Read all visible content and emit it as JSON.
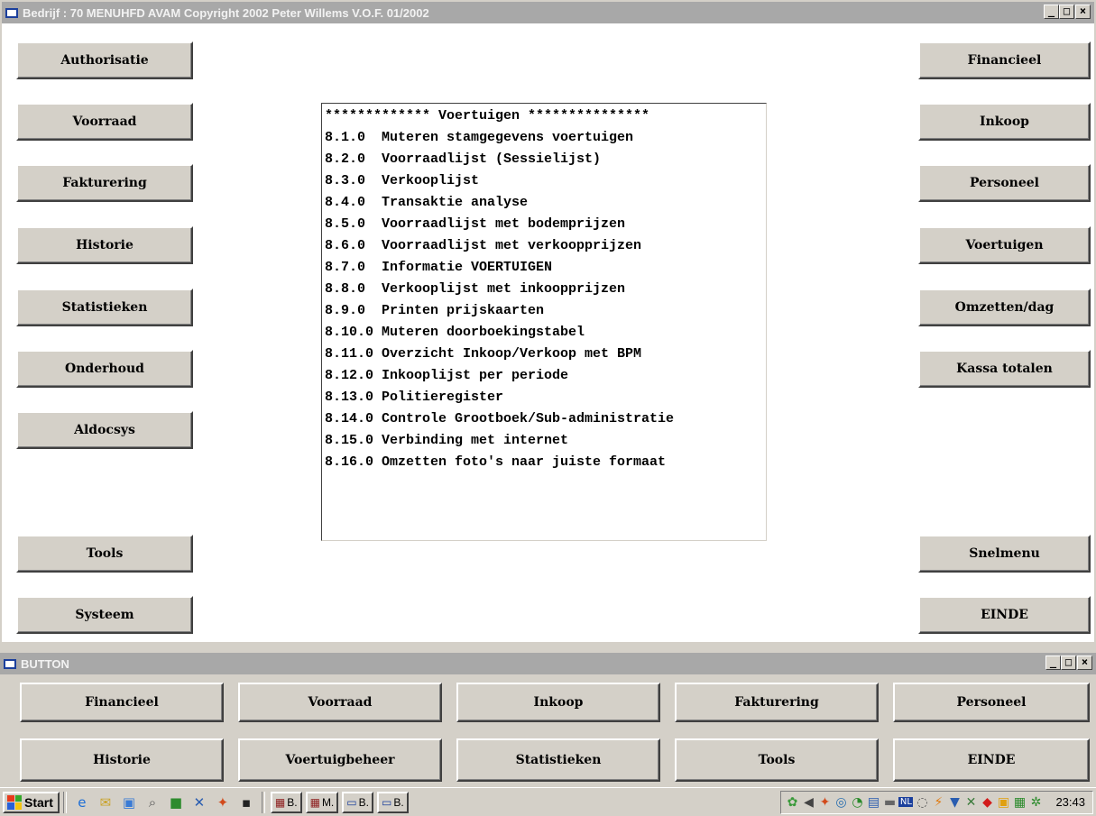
{
  "main_window": {
    "title": "Bedrijf : 70 MENUHFD   AVAM Copyright 2002 Peter Willems V.O.F.    01/2002",
    "left_buttons": [
      "Authorisatie",
      "Voorraad",
      "Fakturering",
      "Historie",
      "Statistieken",
      "Onderhoud",
      "Aldocsys",
      "Tools",
      "Systeem"
    ],
    "right_buttons": [
      "Financieel",
      "Inkoop",
      "Personeel",
      "Voertuigen",
      "Omzetten/dag",
      "Kassa totalen",
      "Snelmenu",
      "EINDE"
    ],
    "menu_lines": [
      "************* Voertuigen ***************",
      "8.1.0  Muteren stamgegevens voertuigen",
      "8.2.0  Voorraadlijst (Sessielijst)",
      "8.3.0  Verkooplijst",
      "8.4.0  Transaktie analyse",
      "8.5.0  Voorraadlijst met bodemprijzen",
      "8.6.0  Voorraadlijst met verkoopprijzen",
      "8.7.0  Informatie VOERTUIGEN",
      "8.8.0  Verkooplijst met inkoopprijzen",
      "8.9.0  Printen prijskaarten",
      "8.10.0 Muteren doorboekingstabel",
      "8.11.0 Overzicht Inkoop/Verkoop met BPM",
      "8.12.0 Inkooplijst per periode",
      "8.13.0 Politieregister",
      "8.14.0 Controle Grootboek/Sub-administratie",
      "8.15.0 Verbinding met internet",
      "8.16.0 Omzetten foto's naar juiste formaat"
    ]
  },
  "button_window": {
    "title": "BUTTON",
    "row1": [
      "Financieel",
      "Voorraad",
      "Inkoop",
      "Fakturering",
      "Personeel"
    ],
    "row2": [
      "Historie",
      "Voertuigbeheer",
      "Statistieken",
      "Tools",
      "EINDE"
    ]
  },
  "window_controls": {
    "minimize": "_",
    "maximize": "□",
    "close": "×"
  },
  "taskbar": {
    "start_label": "Start",
    "task_buttons": [
      "B.",
      "M.",
      "B.",
      "B."
    ],
    "clock": "23:43"
  }
}
